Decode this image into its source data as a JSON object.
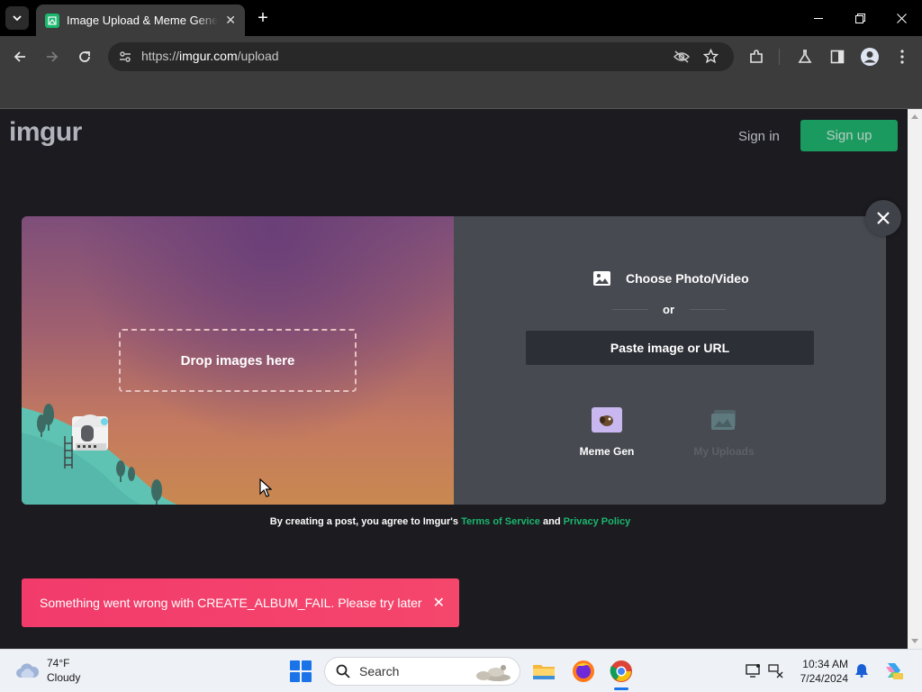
{
  "browser": {
    "tab_title": "Image Upload & Meme Generator",
    "url_prefix": "https://",
    "url_domain": "imgur.com",
    "url_path": "/upload"
  },
  "site": {
    "logo": "imgur",
    "signin_label": "Sign in",
    "signup_label": "Sign up"
  },
  "upload": {
    "drop_label": "Drop images here",
    "choose_label": "Choose Photo/Video",
    "or_label": "or",
    "paste_label": "Paste image or URL",
    "meme_label": "Meme Gen",
    "uploads_label": "My Uploads"
  },
  "terms": {
    "prefix": "By creating a post, you agree to Imgur's ",
    "tos": "Terms of Service",
    "and": " and ",
    "privacy": "Privacy Policy"
  },
  "error": {
    "message": "Something went wrong with CREATE_ALBUM_FAIL. Please try later"
  },
  "taskbar": {
    "temp": "74°F",
    "condition": "Cloudy",
    "search_label": "Search",
    "time": "10:34 AM",
    "date": "7/24/2024"
  },
  "colors": {
    "accent_green": "#1bb76e",
    "error_pink": "#f23b6b",
    "page_bg": "#1b1b20",
    "panel_gray": "#474a51"
  },
  "icons": [
    "tab-search-icon",
    "favicon-icon",
    "close-icon",
    "plus-icon",
    "minimize-icon",
    "restore-icon",
    "back-icon",
    "forward-icon",
    "reload-icon",
    "site-info-icon",
    "eye-off-icon",
    "star-icon",
    "extensions-icon",
    "labs-icon",
    "side-panel-icon",
    "profile-icon",
    "menu-icon",
    "photo-icon",
    "meme-icon",
    "uploads-icon",
    "cloud-icon",
    "windows-start-icon",
    "search-icon",
    "file-explorer-icon",
    "firefox-icon",
    "chrome-icon",
    "notification-bell-icon",
    "copilot-icon"
  ]
}
